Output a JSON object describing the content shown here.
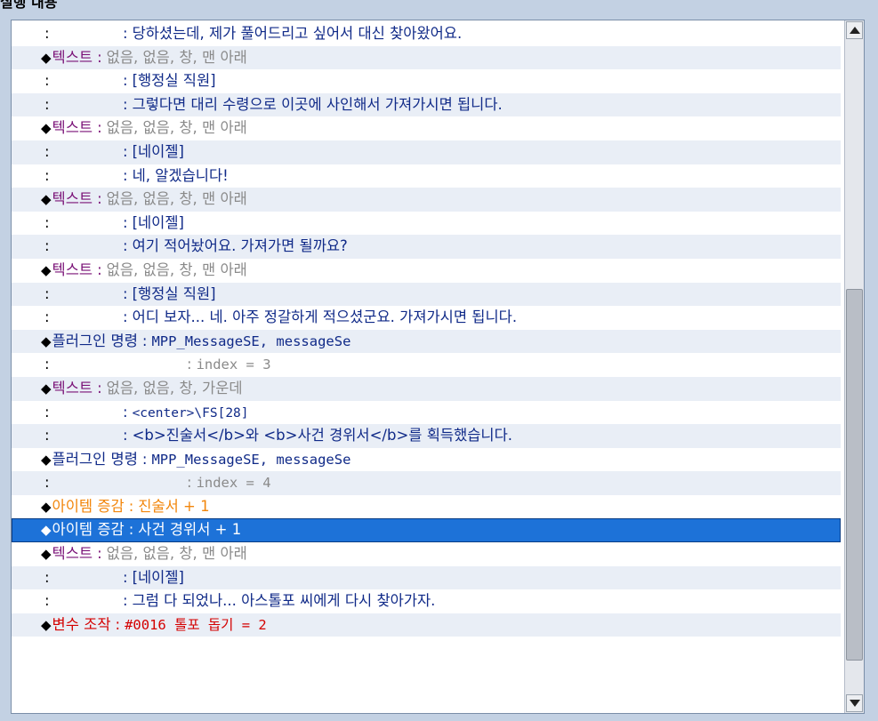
{
  "panel": {
    "title": "실행 내용"
  },
  "rows": [
    {
      "type": "cont",
      "text": "당하셨는데, 제가 풀어드리고 싶어서 대신 찾아왔어요.",
      "color": "navy"
    },
    {
      "type": "cmd",
      "cmd": "텍스트",
      "cmd_color": "purple",
      "text": "없음, 없음, 창, 맨 아래",
      "color": "gray"
    },
    {
      "type": "cont",
      "text": "[행정실 직원]",
      "color": "navy"
    },
    {
      "type": "cont",
      "text": "그렇다면 대리 수령으로 이곳에 사인해서 가져가시면 됩니다.",
      "color": "navy"
    },
    {
      "type": "cmd",
      "cmd": "텍스트",
      "cmd_color": "purple",
      "text": "없음, 없음, 창, 맨 아래",
      "color": "gray"
    },
    {
      "type": "cont",
      "text": "[네이젤]",
      "color": "navy"
    },
    {
      "type": "cont",
      "text": "네, 알겠습니다!",
      "color": "navy"
    },
    {
      "type": "cmd",
      "cmd": "텍스트",
      "cmd_color": "purple",
      "text": "없음, 없음, 창, 맨 아래",
      "color": "gray"
    },
    {
      "type": "cont",
      "text": "[네이젤]",
      "color": "navy"
    },
    {
      "type": "cont",
      "text": "여기 적어놨어요. 가져가면 될까요?",
      "color": "navy"
    },
    {
      "type": "cmd",
      "cmd": "텍스트",
      "cmd_color": "purple",
      "text": "없음, 없음, 창, 맨 아래",
      "color": "gray"
    },
    {
      "type": "cont",
      "text": "[행정실 직원]",
      "color": "navy"
    },
    {
      "type": "cont",
      "text": "어디 보자... 네. 아주 정갈하게 적으셨군요. 가져가시면 됩니다.",
      "color": "navy"
    },
    {
      "type": "cmd",
      "cmd": "플러그인 명령",
      "cmd_color": "navy",
      "text": "MPP_MessageSE, messageSe",
      "color": "navy",
      "mono": true
    },
    {
      "type": "cont",
      "indent": "wide",
      "text": "index = 3",
      "color": "gray",
      "mono": true
    },
    {
      "type": "cmd",
      "cmd": "텍스트",
      "cmd_color": "purple",
      "text": "없음, 없음, 창, 가운데",
      "color": "gray"
    },
    {
      "type": "cont",
      "text": "<center>\\FS[28]",
      "color": "navy",
      "mono_sm": true
    },
    {
      "type": "cont",
      "text": "<b>진술서</b>와 <b>사건 경위서</b>를 획득했습니다.",
      "color": "navy"
    },
    {
      "type": "cmd",
      "cmd": "플러그인 명령",
      "cmd_color": "navy",
      "text": "MPP_MessageSE, messageSe",
      "color": "navy",
      "mono": true
    },
    {
      "type": "cont",
      "indent": "wide",
      "text": "index = 4",
      "color": "gray",
      "mono": true
    },
    {
      "type": "cmd",
      "cmd": "아이템 증감",
      "cmd_color": "orange",
      "text": "진술서 + 1",
      "color": "orange"
    },
    {
      "type": "cmd",
      "cmd": "아이템 증감",
      "cmd_color": "white",
      "text": "사건 경위서 + 1",
      "color": "white",
      "selected": true
    },
    {
      "type": "cmd",
      "cmd": "텍스트",
      "cmd_color": "purple",
      "text": "없음, 없음, 창, 맨 아래",
      "color": "gray"
    },
    {
      "type": "cont",
      "text": "[네이젤]",
      "color": "navy"
    },
    {
      "type": "cont",
      "text": "그럼 다 되었나... 아스톨포 씨에게 다시 찾아가자.",
      "color": "navy"
    },
    {
      "type": "cmd",
      "cmd": "변수 조작",
      "cmd_color": "red",
      "text": "#0016 톨포 돕기 = 2",
      "color": "red",
      "mono": true
    }
  ],
  "symbols": {
    "diamond": "◆",
    "colon": ":"
  }
}
